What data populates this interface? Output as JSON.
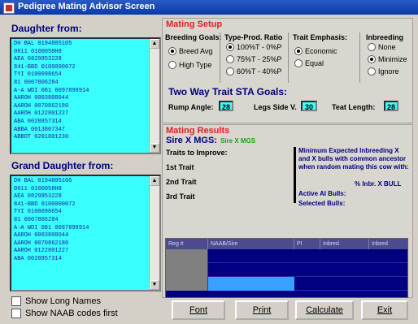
{
  "window": {
    "title": "Pedigree Mating Advisor Screen"
  },
  "daughter": {
    "label": "Daughter from:",
    "items": [
      "DH BAL 0194805105",
      "0011 0100058H8",
      "AEA 0829853228",
      "841-BBD 0100000072",
      "TYI 0100098654",
      "81 0007806284",
      "A-A WDI 081 0097898914",
      "AAROH 0003808044",
      "AAROH 0070862180",
      "AAROH 0122801227",
      "ABA 0028857314",
      "ABBA 0013807347",
      "ABBOT 0201801230"
    ]
  },
  "granddaughter": {
    "label": "Grand Daughter from:",
    "items": [
      "DH BAL 0194805105",
      "0011 0100058H8",
      "AEA 0829853228",
      "841-BBD 0100000072",
      "TYI 0100098654",
      "81 0007806284",
      "A-A WDI 081 0097898914",
      "AAROH 0003808044",
      "AAROH 0070862180",
      "AAROH 0122801227",
      "ABA 0028857314"
    ]
  },
  "options": {
    "show_long_names": "Show Long Names",
    "show_naab_first": "Show NAAB codes first"
  },
  "mating_setup": {
    "title": "Mating Setup",
    "breeding_goals": {
      "title": "Breeding Goals:",
      "opt1": "Breed Avg",
      "opt2": "High Type",
      "selected": "Breed Avg"
    },
    "type_prod": {
      "title": "Type-Prod. Ratio",
      "opt1": "100%T - 0%P",
      "opt2": "75%T - 25%P",
      "opt3": "60%T - 40%P",
      "selected": "100%T - 0%P"
    },
    "trait_emphasis": {
      "title": "Trait Emphasis:",
      "opt1": "Economic",
      "opt2": "Equal",
      "selected": "Economic"
    },
    "inbreeding": {
      "title": "Inbreeding",
      "opt1": "None",
      "opt2": "Minimize",
      "opt3": "Ignore",
      "selected": "Minimize"
    },
    "two_way": {
      "title": "Two Way Trait STA Goals:",
      "rump_label": "Rump Angle:",
      "rump_value": "28",
      "legs_label": "Legs Side V.",
      "legs_value": "30",
      "teat_label": "Teat Length:",
      "teat_value": "28"
    }
  },
  "results": {
    "title": "Mating Results",
    "sire_label": "Sire X MGS:",
    "sire_value": "Sire X MGS",
    "traits_label": "Traits to Improve:",
    "t1": "1st Trait",
    "t2": "2nd Trait",
    "t3": "3rd Trait",
    "inbreeding_note": "Minimum Expected Inbreeding X and X bulls with common ancestor when random mating this cow with:",
    "index_note": "% Inbr. X BULL",
    "active_bulls": "Active AI Bulls:",
    "selected_bulls": "Selected Bulls:",
    "grid_headers": [
      "Reg #",
      "NAAB/Sire",
      "PI",
      "Inbred",
      "Inbred"
    ]
  },
  "buttons": {
    "font": "Font",
    "print": "Print",
    "calculate": "Calculate",
    "exit": "Exit"
  },
  "colors": {
    "list_bg": "#39ffff",
    "grid_bg": "#000080",
    "selected_cell": "#3aa0ff",
    "section_title": "#e02020",
    "heading_blue": "#000080"
  }
}
